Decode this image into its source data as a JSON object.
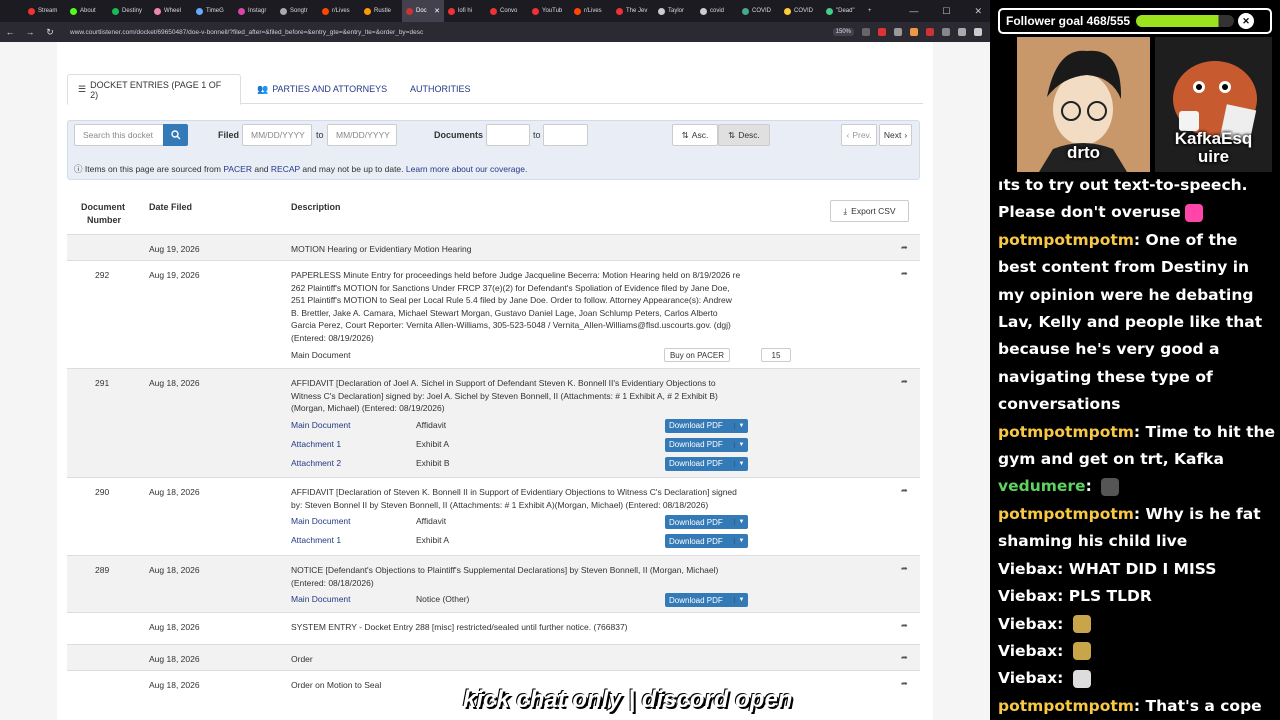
{
  "browser": {
    "tabs": [
      {
        "label": "Stream",
        "color": "#e33"
      },
      {
        "label": "About",
        "color": "#53fc18"
      },
      {
        "label": "Destiny",
        "color": "#1db954"
      },
      {
        "label": "Wheel",
        "color": "#e8a"
      },
      {
        "label": "TimeG",
        "color": "#6af"
      },
      {
        "label": "Instagr",
        "color": "#d4a"
      },
      {
        "label": "Songtr",
        "color": "#aaa"
      },
      {
        "label": "r/Lives",
        "color": "#ff4500"
      },
      {
        "label": "Rustle",
        "color": "#f90"
      },
      {
        "label": "Doc",
        "color": "#c33",
        "active": true
      },
      {
        "label": "lofi hi",
        "color": "#e33"
      },
      {
        "label": "Convo",
        "color": "#e33"
      },
      {
        "label": "YouTub",
        "color": "#e33"
      },
      {
        "label": "r/Lives",
        "color": "#ff4500"
      },
      {
        "label": "The Jev",
        "color": "#e33"
      },
      {
        "label": "Taylor",
        "color": "#ccc"
      },
      {
        "label": "covid",
        "color": "#ccc"
      },
      {
        "label": "COVID",
        "color": "#4a8"
      },
      {
        "label": "COVID",
        "color": "#fc3"
      },
      {
        "label": "\"Dead\"",
        "color": "#4c8"
      }
    ],
    "url": "www.courtlistener.com/docket/69650487/doe-v-bonnell/?filed_after=&filed_before=&entry_gte=&entry_lte=&order_by=desc",
    "zoom": "150%"
  },
  "page": {
    "tabs": {
      "entries": "DOCKET ENTRIES (PAGE 1 OF 2)",
      "parties": "PARTIES AND ATTORNEYS",
      "authorities": "AUTHORITIES"
    },
    "filters": {
      "search_placeholder": "Search this docket",
      "filed_label": "Filed",
      "date_placeholder": "MM/DD/YYYY",
      "to_label": "to",
      "documents_label": "Documents",
      "asc_label": "Asc.",
      "desc_label": "Desc.",
      "prev_label": "Prev.",
      "next_label": "Next"
    },
    "info": {
      "part1": "Items on this page are sourced from ",
      "pacer": "PACER",
      "and": " and ",
      "recap": "RECAP",
      "part2": " and may not be up to date. ",
      "learn": "Learn more about our coverage."
    },
    "table": {
      "col_docnum_1": "Document",
      "col_docnum_2": "Number",
      "col_date": "Date Filed",
      "col_desc": "Description",
      "export": "Export CSV",
      "download_label": "Download PDF",
      "buy_pacer": "Buy on PACER",
      "rows": [
        {
          "num": "",
          "date": "Aug 19, 2026",
          "desc": "MOTION Hearing or Evidentiary Motion Hearing"
        },
        {
          "num": "292",
          "date": "Aug 19, 2026",
          "desc": [
            "PAPERLESS Minute Entry for proceedings held before Judge Jacqueline Becerra: Motion Hearing held on 8/19/2026 re",
            "262 Plaintiff's MOTION for Sanctions Under FRCP 37(e)(2) for Defendant's Spoliation of Evidence filed by Jane Doe,",
            "251 Plaintiff's MOTION to Seal per Local Rule 5.4 filed by Jane Doe. Order to follow. Attorney Appearance(s): Andrew",
            "B. Brettler, Jake A. Camara, Michael Stewart Morgan, Gustavo Daniel Lage, Joan Schlump Peters, Carlos Alberto",
            "Garcia Perez, Court Reporter: Vernita Allen-Williams, 305-523-5048 / Vernita_Allen-Williams@flsd.uscourts.gov. (dgj)",
            "(Entered: 08/19/2026)"
          ],
          "main_doc": "Main Document",
          "buy_count": "15"
        },
        {
          "num": "291",
          "date": "Aug 18, 2026",
          "desc": [
            "AFFIDAVIT [Declaration of Joel A. Sichel in Support of Defendant Steven K. Bonnell II's Evidentiary Objections to",
            "Witness C's Declaration] signed by: Joel A. Sichel by Steven Bonnell, II (Attachments: # 1 Exhibit A, # 2 Exhibit B)",
            "(Morgan, Michael) (Entered: 08/19/2026)"
          ],
          "docs": [
            {
              "link": "Main Document",
              "label": "Affidavit"
            },
            {
              "link": "Attachment 1",
              "label": "Exhibit A"
            },
            {
              "link": "Attachment 2",
              "label": "Exhibit B"
            }
          ]
        },
        {
          "num": "290",
          "date": "Aug 18, 2026",
          "desc": [
            "AFFIDAVIT [Declaration of Steven K. Bonnell II in Support of Evidentiary Objections to Witness C's Declaration] signed",
            "by: Steven Bonnel II by Steven Bonnell, II (Attachments: # 1 Exhibit A)(Morgan, Michael) (Entered: 08/18/2026)"
          ],
          "docs": [
            {
              "link": "Main Document",
              "label": "Affidavit"
            },
            {
              "link": "Attachment 1",
              "label": "Exhibit A"
            }
          ]
        },
        {
          "num": "289",
          "date": "Aug 18, 2026",
          "desc": [
            "NOTICE [Defendant's Objections to Plaintiff's Supplemental Declarations] by Steven Bonnell, II (Morgan, Michael)",
            "(Entered: 08/18/2026)"
          ],
          "docs": [
            {
              "link": "Main Document",
              "label": "Notice (Other)"
            }
          ]
        },
        {
          "num": "",
          "date": "Aug 18, 2026",
          "desc": "SYSTEM ENTRY - Docket Entry 288 [misc] restricted/sealed until further notice. (766837)"
        },
        {
          "num": "",
          "date": "Aug 18, 2026",
          "desc": "Order"
        },
        {
          "num": "",
          "date": "Aug 18, 2026",
          "desc": "Order on Motion to Seal"
        }
      ]
    }
  },
  "stream": {
    "goal_text": "Follower goal 468/555",
    "goal_fraction": 0.84,
    "cam1_label": "drto",
    "cam2_label_1": "KafkaEsq",
    "cam2_label_2": "uire",
    "caption": "kick chat only | discord open",
    "chat": [
      {
        "user": "",
        "text": "ıts to try out text-to-speech."
      },
      {
        "user": "",
        "text": "Please don't overuse",
        "emote": "#f4a"
      },
      {
        "user": "potmpotmpotm",
        "text": "One of the best content from Destiny in my opinion were he debating Lav, Kelly and people like that because he's very good a navigating these type of conversations"
      },
      {
        "user": "potmpotmpotm",
        "text": "Time to hit the gym and get on trt, Kafka"
      },
      {
        "user": "vedumere",
        "text": "",
        "green": true,
        "emote": "#555"
      },
      {
        "user": "potmpotmpotm",
        "text": "Why is he fat shaming his child live"
      },
      {
        "user": "Viebax",
        "text": "WHAT DID I MISS",
        "white": true
      },
      {
        "user": "Viebax",
        "text": "PLS TLDR",
        "white": true
      },
      {
        "user": "Viebax",
        "text": "",
        "white": true,
        "emote": "#c9a54a"
      },
      {
        "user": "Viebax",
        "text": "",
        "white": true,
        "emote": "#c9a54a"
      },
      {
        "user": "Viebax",
        "text": "",
        "white": true,
        "emote": "#ddd"
      },
      {
        "user": "potmpotmpotm",
        "text": "That's a cope"
      }
    ]
  }
}
